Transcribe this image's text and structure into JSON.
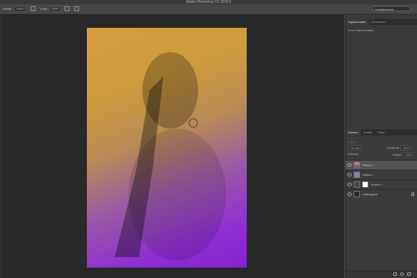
{
  "window": {
    "title": "Adobe Photoshop CC 2015.5"
  },
  "options_bar": {
    "deckkraft_label": "Deckkr.:",
    "deckkraft_value": "100%",
    "fluss_label": "Fluss:",
    "fluss_value": "100%",
    "workspace": "Grundelemente"
  },
  "properties_panel": {
    "tabs": [
      "Eigenschaften",
      "Korrekturen"
    ],
    "empty_text": "Keine Eigenschaften"
  },
  "layers_panel": {
    "tabs": [
      "Ebenen",
      "Kanäle",
      "Pfade"
    ],
    "filter_label": "Art",
    "blend_mode": "Normal",
    "opacity_label": "Deckkraft:",
    "opacity_value": "100%",
    "fill_label": "Fläche:",
    "fill_value": "100%",
    "lock_label": "Fixieren:",
    "layers": [
      {
        "name": "Ebene 2",
        "selected": true
      },
      {
        "name": "Ebene 1",
        "selected": false
      },
      {
        "name": "Kurven 1",
        "selected": false
      },
      {
        "name": "Hintergrund",
        "selected": false
      }
    ]
  },
  "colors": {
    "gradient_top": "#d69d42",
    "gradient_bottom": "#8622cf",
    "ui_dark": "#282828",
    "panel": "#3a3a3a"
  }
}
